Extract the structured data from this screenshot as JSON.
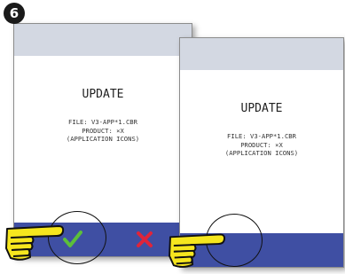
{
  "step": {
    "number": "6"
  },
  "screens": [
    {
      "title": "UPDATE",
      "file_line": "FILE: V3-APP*1.CBR",
      "product_line": "PRODUCT: ×X",
      "icons_line": "(APPLICATION ICONS)",
      "buttons": [
        "check-icon",
        "cross-icon"
      ]
    },
    {
      "title": "UPDATE",
      "file_line": "FILE: V3-APP*1.CBR",
      "product_line": "PRODUCT: ×X",
      "icons_line": "(APPLICATION ICONS)",
      "buttons": []
    }
  ],
  "colors": {
    "top_bar": "#d3d8e2",
    "bottom_bar": "#3f4fa3",
    "confirm": "#5cbf3a",
    "cancel": "#e0243a",
    "hand": "#f6e61e"
  }
}
